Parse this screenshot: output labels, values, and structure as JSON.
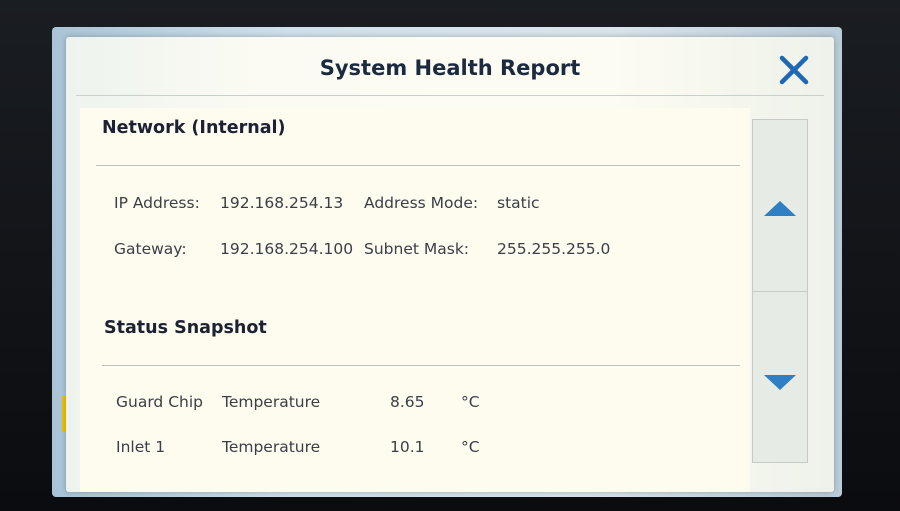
{
  "dialog": {
    "title": "System Health Report",
    "close_icon": "close-icon",
    "accent_color": "#1f68b5"
  },
  "network": {
    "title": "Network (Internal)",
    "ip_label": "IP Address:",
    "ip_value": "192.168.254.13",
    "mode_label": "Address Mode:",
    "mode_value": "static",
    "gateway_label": "Gateway:",
    "gateway_value": "192.168.254.100",
    "subnet_label": "Subnet Mask:",
    "subnet_value": "255.255.255.0"
  },
  "status": {
    "title": "Status Snapshot",
    "rows": [
      {
        "name": "Guard Chip",
        "metric": "Temperature",
        "value": "8.65",
        "unit": "°C"
      },
      {
        "name": "Inlet 1",
        "metric": "Temperature",
        "value": "10.1",
        "unit": "°C"
      }
    ]
  },
  "scrollbar": {
    "up_icon": "arrow-up-icon",
    "down_icon": "arrow-down-icon",
    "arrow_color": "#2f7fc5"
  }
}
